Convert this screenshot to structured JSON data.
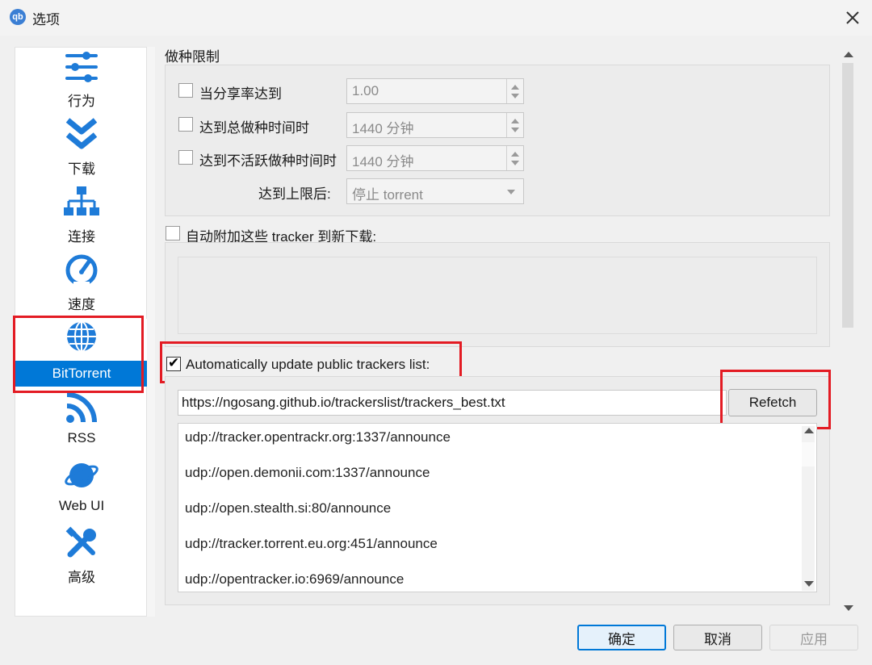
{
  "window": {
    "title": "选项",
    "app_icon_text": "qb"
  },
  "sidebar": {
    "items": [
      {
        "label": "行为",
        "icon": "sliders-icon"
      },
      {
        "label": "下载",
        "icon": "double-chevron-down-icon"
      },
      {
        "label": "连接",
        "icon": "network-icon"
      },
      {
        "label": "速度",
        "icon": "speedometer-icon"
      },
      {
        "label": "BitTorrent",
        "icon": "globe-icon",
        "selected": true
      },
      {
        "label": "RSS",
        "icon": "rss-icon"
      },
      {
        "label": "Web UI",
        "icon": "planet-icon"
      },
      {
        "label": "高级",
        "icon": "tools-icon"
      }
    ]
  },
  "seeding": {
    "group_title": "做种限制",
    "ratio_label": "当分享率达到",
    "ratio_value": "1.00",
    "total_time_label": "达到总做种时间时",
    "total_time_value": "1440 分钟",
    "inactive_time_label": "达到不活跃做种时间时",
    "inactive_time_value": "1440 分钟",
    "limit_action_label": "达到上限后:",
    "limit_action_value": "停止 torrent"
  },
  "auto_trackers": {
    "label": "自动附加这些 tracker 到新下载:",
    "checked": false
  },
  "public_trackers": {
    "label": "Automatically update public trackers list:",
    "checked": true,
    "url": "https://ngosang.github.io/trackerslist/trackers_best.txt",
    "refetch_label": "Refetch",
    "list": [
      "udp://tracker.opentrackr.org:1337/announce",
      "udp://open.demonii.com:1337/announce",
      "udp://open.stealth.si:80/announce",
      "udp://tracker.torrent.eu.org:451/announce",
      "udp://opentracker.io:6969/announce"
    ]
  },
  "footer": {
    "ok": "确定",
    "cancel": "取消",
    "apply": "应用"
  },
  "colors": {
    "accent": "#0078d7",
    "annotation_red": "#e31b23"
  }
}
